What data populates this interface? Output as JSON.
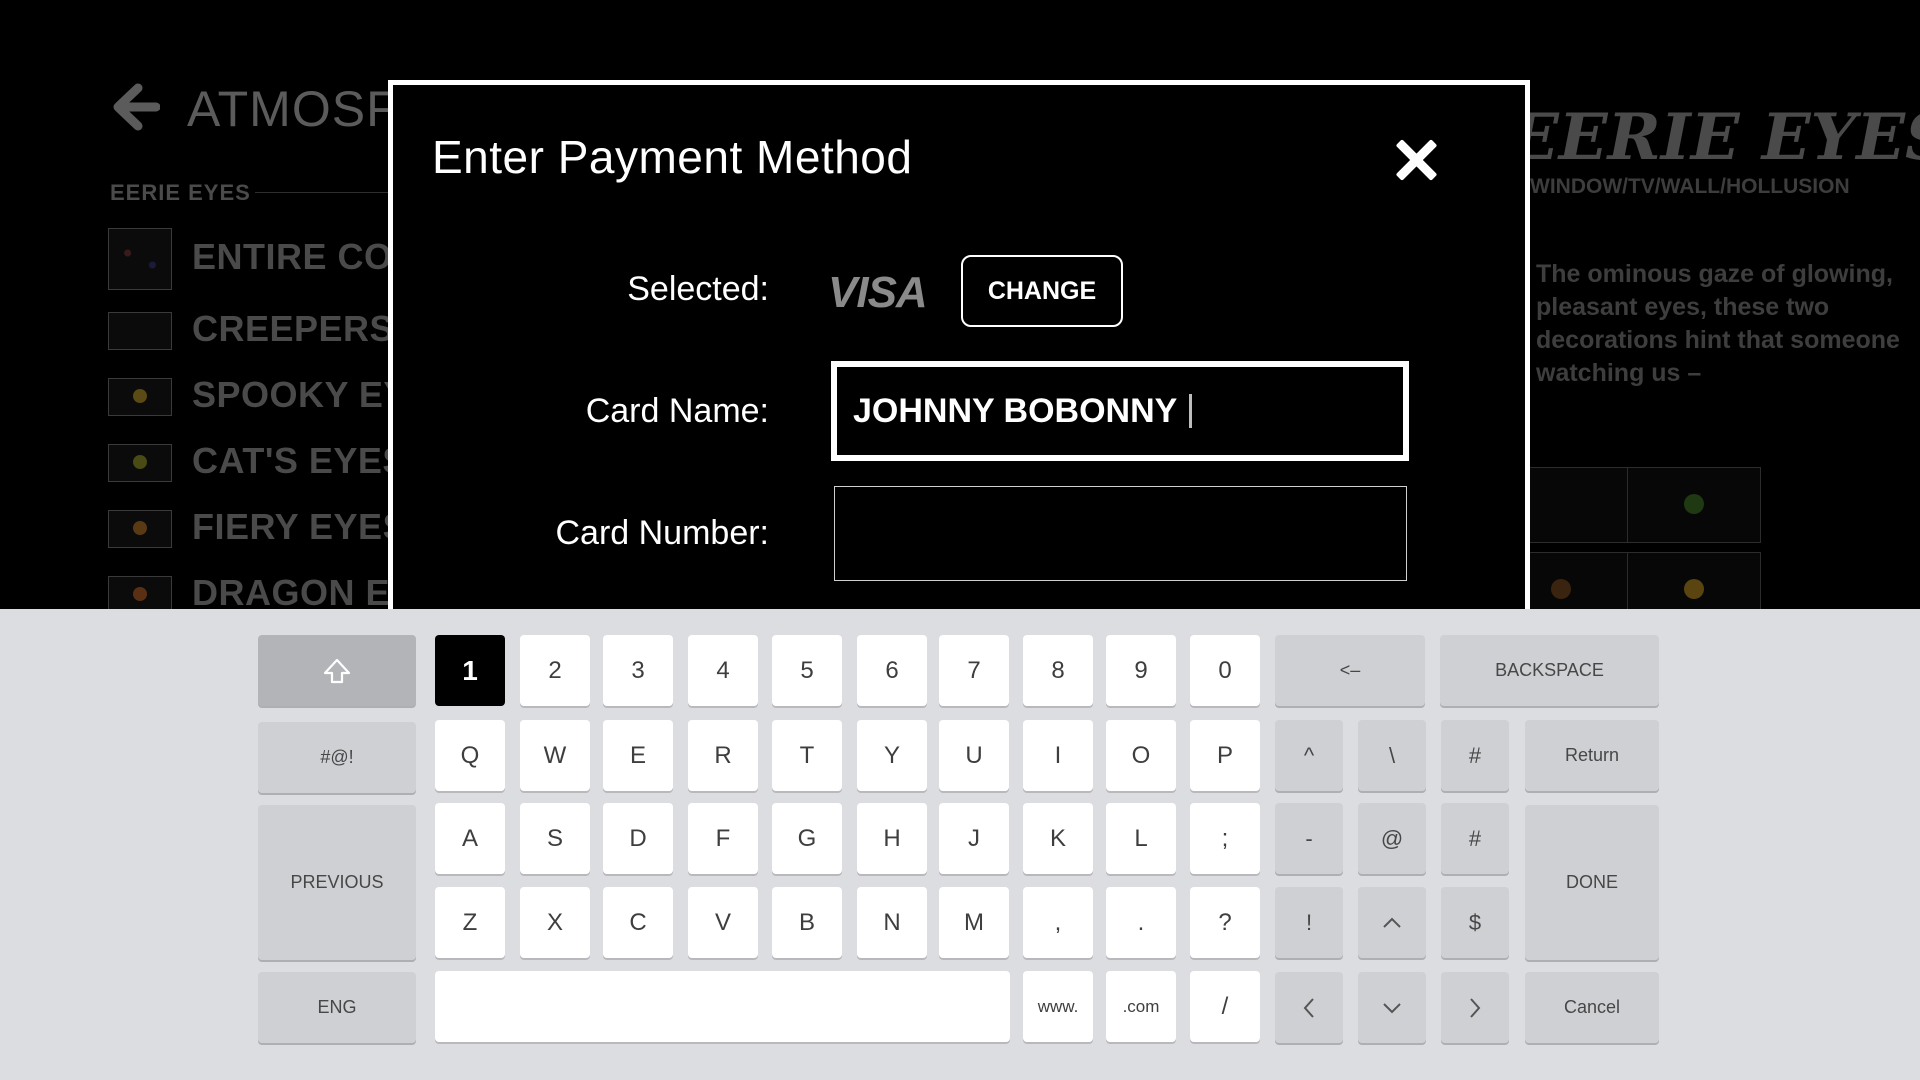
{
  "background": {
    "title": "ATMOSFX",
    "section": "EERIE EYES",
    "items": [
      {
        "label": "ENTIRE COLLECTION"
      },
      {
        "label": "CREEPERS PEEPERS"
      },
      {
        "label": "SPOOKY EYES"
      },
      {
        "label": "CAT'S EYES"
      },
      {
        "label": "FIERY EYES"
      },
      {
        "label": "DRAGON EYES"
      }
    ],
    "logo": "EERIE EYES",
    "subtitle": "WINDOW/TV/WALL/HOLLUSION",
    "description": "The ominous gaze of glowing, pleasant eyes, these two decorations hint that someone watching us –"
  },
  "modal": {
    "title": "Enter Payment Method",
    "selected_label": "Selected:",
    "card_brand": "VISA",
    "change_label": "CHANGE",
    "card_name_label": "Card Name:",
    "card_name_value": "JOHNNY BOBONNY",
    "card_number_label": "Card Number:",
    "card_number_value": ""
  },
  "keyboard": {
    "shift_icon": "shift-icon",
    "symbols": "#@!",
    "previous": "PREVIOUS",
    "lang": "ENG",
    "backspace": "BACKSPACE",
    "left_arrow": "<–",
    "return": "Return",
    "done": "DONE",
    "cancel": "Cancel",
    "www": "www.",
    "com": ".com",
    "row1": [
      "1",
      "2",
      "3",
      "4",
      "5",
      "6",
      "7",
      "8",
      "9",
      "0"
    ],
    "row2": [
      "Q",
      "W",
      "E",
      "R",
      "T",
      "Y",
      "U",
      "I",
      "O",
      "P"
    ],
    "row3": [
      "A",
      "S",
      "D",
      "F",
      "G",
      "H",
      "J",
      "K",
      "L",
      ";"
    ],
    "row4": [
      "Z",
      "X",
      "C",
      "V",
      "B",
      "N",
      "M",
      ",",
      ".",
      "?"
    ],
    "row5": [
      "/"
    ],
    "sym_row2": [
      "^",
      "\\",
      "#"
    ],
    "sym_row3": [
      "-",
      "@",
      "#"
    ],
    "sym_row4": [
      "!",
      "^",
      "$"
    ],
    "sym_row5": [
      "<",
      "v",
      ">"
    ],
    "selected_key": "1"
  }
}
